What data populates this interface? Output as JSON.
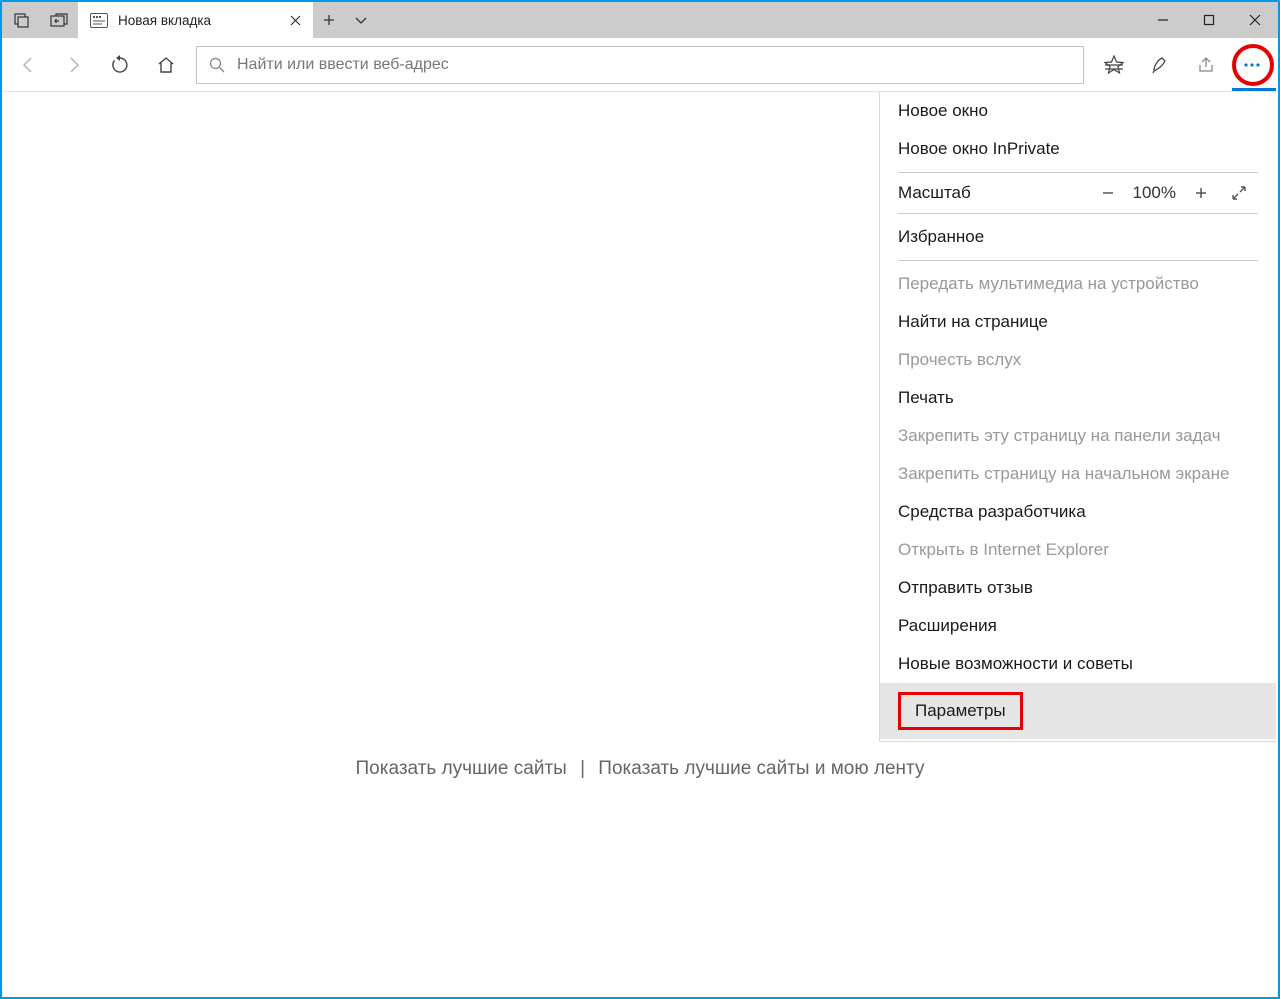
{
  "tab": {
    "title": "Новая вкладка"
  },
  "addressbar": {
    "placeholder": "Найти или ввести веб-адрес"
  },
  "startpage": {
    "link1": "Показать лучшие сайты",
    "sep": "|",
    "link2": "Показать лучшие сайты и мою ленту"
  },
  "menu": {
    "newWindow": "Новое окно",
    "newInPrivate": "Новое окно InPrivate",
    "zoomLabel": "Масштаб",
    "zoomValue": "100%",
    "favorites": "Избранное",
    "castMedia": "Передать мультимедиа на устройство",
    "findOnPage": "Найти на странице",
    "readAloud": "Прочесть вслух",
    "print": "Печать",
    "pinTaskbar": "Закрепить эту страницу на панели задач",
    "pinStart": "Закрепить страницу на начальном экране",
    "devTools": "Средства разработчика",
    "openIE": "Открыть в Internet Explorer",
    "feedback": "Отправить отзыв",
    "extensions": "Расширения",
    "whatsNew": "Новые возможности и советы",
    "settings": "Параметры"
  }
}
